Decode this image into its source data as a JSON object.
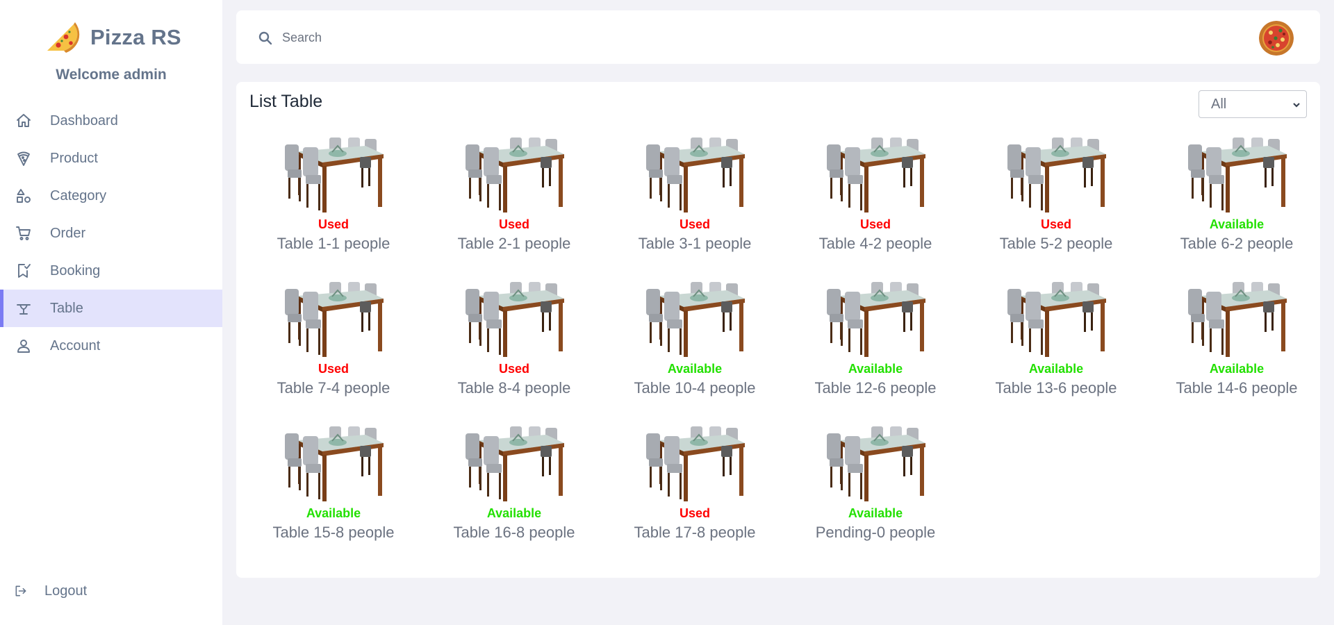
{
  "brand": {
    "name": "Pizza RS",
    "logo_icon": "pizza-slice-icon"
  },
  "welcome": "Welcome admin",
  "nav": [
    {
      "label": "Dashboard",
      "icon": "home-icon"
    },
    {
      "label": "Product",
      "icon": "pizza-icon"
    },
    {
      "label": "Category",
      "icon": "shapes-icon"
    },
    {
      "label": "Order",
      "icon": "cart-icon"
    },
    {
      "label": "Booking",
      "icon": "bookmark-check-icon"
    },
    {
      "label": "Table",
      "icon": "table-icon",
      "active": true
    },
    {
      "label": "Account",
      "icon": "user-icon"
    }
  ],
  "logout": {
    "label": "Logout",
    "icon": "logout-icon"
  },
  "search": {
    "placeholder": "Search",
    "value": ""
  },
  "main": {
    "title": "List Table",
    "filter": {
      "selected": "All"
    },
    "tables": [
      {
        "name": "Table 1-1 people",
        "status": "Used"
      },
      {
        "name": "Table 2-1 people",
        "status": "Used"
      },
      {
        "name": "Table 3-1 people",
        "status": "Used"
      },
      {
        "name": "Table 4-2 people",
        "status": "Used"
      },
      {
        "name": "Table 5-2 people",
        "status": "Used"
      },
      {
        "name": "Table 6-2 people",
        "status": "Available"
      },
      {
        "name": "Table 7-4 people",
        "status": "Used"
      },
      {
        "name": "Table 8-4 people",
        "status": "Used"
      },
      {
        "name": "Table 10-4 people",
        "status": "Available"
      },
      {
        "name": "Table 12-6 people",
        "status": "Available"
      },
      {
        "name": "Table 13-6 people",
        "status": "Available"
      },
      {
        "name": "Table 14-6 people",
        "status": "Available"
      },
      {
        "name": "Table 15-8 people",
        "status": "Available"
      },
      {
        "name": "Table 16-8 people",
        "status": "Available"
      },
      {
        "name": "Table 17-8 people",
        "status": "Used"
      },
      {
        "name": "Pending-0 people",
        "status": "Available"
      }
    ]
  },
  "colors": {
    "used": "#ff0000",
    "available": "#22e000",
    "accent": "#7b7bf3",
    "active_bg": "#e3e3fc"
  }
}
